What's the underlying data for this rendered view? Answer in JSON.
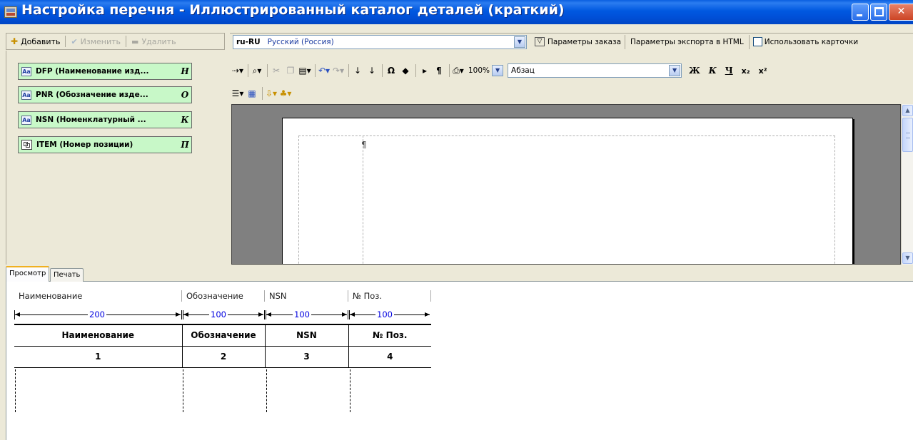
{
  "window": {
    "title": "Настройка перечня - Иллюстрированный каталог деталей (краткий)"
  },
  "left_toolbar": {
    "add_label": "Добавить",
    "edit_label": "Изменить",
    "delete_label": "Удалить"
  },
  "fields": [
    {
      "label": "DFP (Наименование изд...",
      "letter": "Н",
      "icon": "text-field-icon"
    },
    {
      "label": "PNR (Обозначение изде...",
      "letter": "О",
      "icon": "text-field-icon"
    },
    {
      "label": "NSN (Номенклатурный ...",
      "letter": "К",
      "icon": "text-field-icon"
    },
    {
      "label": "ITEM (Номер позиции)",
      "letter": "П",
      "icon": "item-number-icon"
    }
  ],
  "editor": {
    "language_code": "ru-RU",
    "language_name": "Русский (Россия)",
    "order_params_label": "Параметры заказа",
    "export_html_label": "Параметры экспорта в HTML",
    "use_cards_label": "Использовать карточки",
    "use_cards_checked": false,
    "zoom": "100%",
    "style": "Абзац",
    "bold_label": "Ж",
    "italic_label": "К",
    "underline_label": "Ч",
    "subscript_label": "x₂",
    "superscript_label": "x²",
    "pilcrow": "¶"
  },
  "tabs": [
    {
      "label": "Просмотр",
      "active": true
    },
    {
      "label": "Печать",
      "active": false
    }
  ],
  "preview": {
    "column_headers": [
      "Наименование",
      "Обозначение",
      "NSN",
      "№ Поз."
    ],
    "widths": [
      "200",
      "100",
      "100",
      "100"
    ],
    "table_header": [
      "Наименование",
      "Обозначение",
      "NSN",
      "№ Поз."
    ],
    "table_row": [
      "1",
      "2",
      "3",
      "4"
    ]
  }
}
